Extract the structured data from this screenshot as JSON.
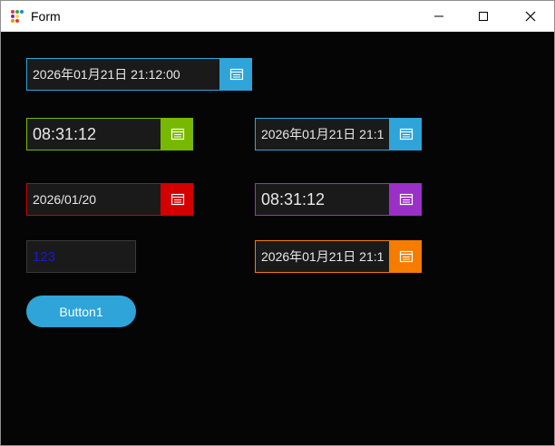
{
  "window": {
    "title": "Form",
    "controls": {
      "minimize": "minimize",
      "maximize": "maximize",
      "close": "close"
    }
  },
  "fields": {
    "datetime_top": {
      "value": "2026年01月21日 21:12:00",
      "accent": "#2fa4d8",
      "icon": "calendar-icon"
    },
    "time_green": {
      "value": "08:31:12",
      "accent": "#76b900",
      "icon": "calendar-icon"
    },
    "date_red": {
      "value": "2026/01/20",
      "accent": "#d40000",
      "icon": "calendar-icon"
    },
    "numeric": {
      "value": "123",
      "text_color": "#1a1ad0"
    },
    "datetime_blue": {
      "value": "2026年01月21日 21:1",
      "accent": "#2fa4d8",
      "icon": "calendar-icon"
    },
    "time_purple": {
      "value": "08:31:12",
      "accent": "#9b30c8",
      "icon": "calendar-icon"
    },
    "datetime_orange": {
      "value": "2026年01月21日 21:1",
      "accent": "#f57c00",
      "icon": "calendar-icon"
    }
  },
  "button1": {
    "label": "Button1",
    "color": "#2fa4d8"
  }
}
